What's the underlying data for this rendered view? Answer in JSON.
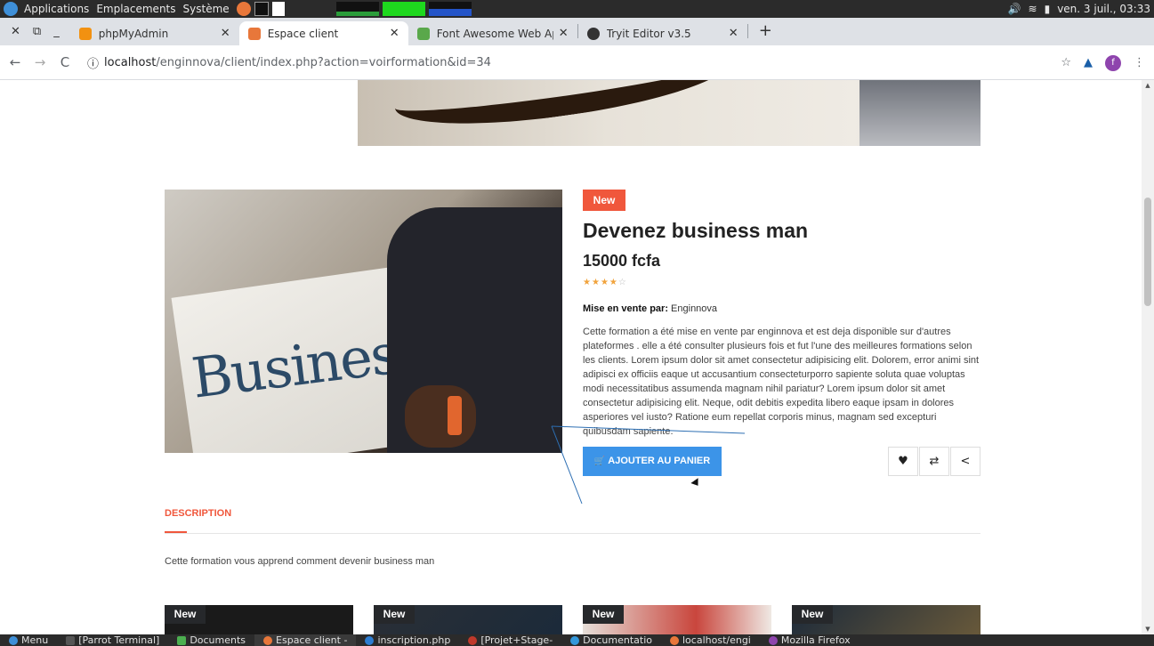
{
  "system_panel": {
    "menus": [
      "Applications",
      "Emplacements",
      "Système"
    ],
    "clock": "ven. 3 juil., 03:33"
  },
  "tabs": [
    {
      "label": "phpMyAdmin",
      "color": "#f29111"
    },
    {
      "label": "Espace client",
      "color": "#e8773a"
    },
    {
      "label": "Font Awesome Web Applic",
      "color": "#5aa84b"
    },
    {
      "label": "Tryit Editor v3.5",
      "color": "#333333"
    }
  ],
  "address": {
    "host": "localhost",
    "path": "/enginnova/client/index.php?action=voirformation&id=34",
    "profile_initial": "f"
  },
  "product": {
    "badge": "New",
    "title": "Devenez business man",
    "price": "15000 fcfa",
    "rating": 4,
    "rating_max": 5,
    "seller_label": "Mise en vente par:",
    "seller_name": "Enginnova",
    "image_word": "Business",
    "description": "Cette formation a été mise en vente par enginnova et est deja disponible sur d'autres plateformes . elle a été consulter plusieurs fois et fut l'une des meilleures formations selon les clients. Lorem ipsum dolor sit amet consectetur adipisicing elit. Dolorem, error animi sint adipisci ex officiis eaque ut accusantium consecteturporro sapiente soluta quae voluptas modi necessitatibus assumenda magnam nihil pariatur? Lorem ipsum dolor sit amet consectetur adipisicing elit. Neque, odit debitis expedita libero eaque ipsam in dolores asperiores vel iusto? Ratione eum repellat corporis minus, magnam sed excepturi quibusdam sapiente.",
    "add_to_cart": "AJOUTER AU PANIER"
  },
  "description_tab": {
    "label": "DESCRIPTION",
    "text": "Cette formation vous apprend comment devenir business man"
  },
  "related_cards": [
    {
      "badge": "New",
      "bg": "#1a1a1a"
    },
    {
      "badge": "New",
      "bg": "#24303a"
    },
    {
      "badge": "New",
      "bg": "#d8cfc9"
    },
    {
      "badge": "New",
      "bg": "#2e3a4a"
    }
  ],
  "taskbar": [
    {
      "label": "Menu",
      "color": "#3e8fd8"
    },
    {
      "label": "[Parrot Terminal]",
      "color": "#555555"
    },
    {
      "label": "Documents",
      "color": "#4caf50"
    },
    {
      "label": "Espace client -",
      "color": "#e8773a"
    },
    {
      "label": "inscription.php",
      "color": "#2d7dd2"
    },
    {
      "label": "[Projet+Stage-",
      "color": "#c0392b"
    },
    {
      "label": "Documentatio",
      "color": "#3498db"
    },
    {
      "label": "localhost/engi",
      "color": "#e8773a"
    },
    {
      "label": "Mozilla Firefox",
      "color": "#8e44ad"
    }
  ]
}
